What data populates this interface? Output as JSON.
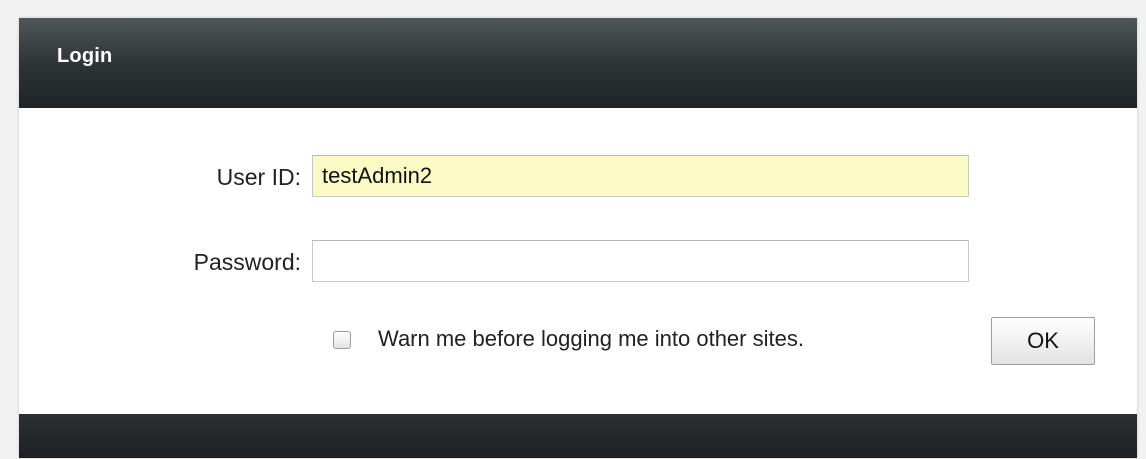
{
  "login": {
    "title": "Login",
    "user_id_label": "User ID:",
    "user_id_value": "testAdmin2",
    "password_label": "Password:",
    "password_value": "",
    "warn_label": "Warn me before logging me into other sites.",
    "warn_checked": false,
    "ok_label": "OK"
  },
  "colors": {
    "header_dark": "#2f3537",
    "footer_dark": "#1f2325",
    "user_id_highlight": "#fbfbc6",
    "panel_background": "#ffffff"
  }
}
